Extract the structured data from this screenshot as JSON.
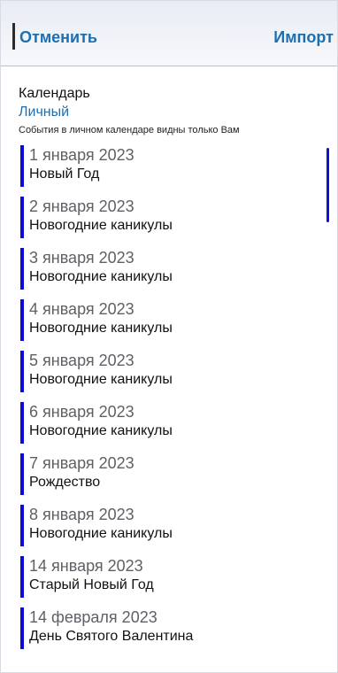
{
  "header": {
    "cancel_label": "Отменить",
    "import_label": "Импорт"
  },
  "calendar": {
    "label": "Календарь",
    "value": "Личный",
    "note": "События в личном календаре видны только Вам"
  },
  "events": [
    {
      "date": "1 января 2023",
      "title": "Новый Год"
    },
    {
      "date": "2 января 2023",
      "title": "Новогодние каникулы"
    },
    {
      "date": "3 января 2023",
      "title": "Новогодние каникулы"
    },
    {
      "date": "4 января 2023",
      "title": "Новогодние каникулы"
    },
    {
      "date": "5 января 2023",
      "title": "Новогодние каникулы"
    },
    {
      "date": "6 января 2023",
      "title": "Новогодние каникулы"
    },
    {
      "date": "7 января 2023",
      "title": "Рождество"
    },
    {
      "date": "8 января 2023",
      "title": "Новогодние каникулы"
    },
    {
      "date": "14 января 2023",
      "title": "Старый Новый Год"
    },
    {
      "date": "14 февраля 2023",
      "title": "День Святого Валентина"
    }
  ],
  "colors": {
    "accent_blue": "#1e6fb0",
    "indicator_blue": "#0b0bd8"
  }
}
